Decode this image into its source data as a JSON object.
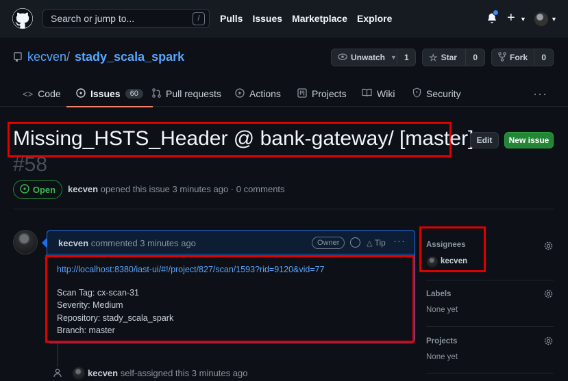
{
  "header": {
    "search_placeholder": "Search or jump to...",
    "search_shortcut": "/",
    "nav": [
      "Pulls",
      "Issues",
      "Marketplace",
      "Explore"
    ],
    "plus": "+"
  },
  "repo": {
    "owner": "kecven",
    "separator": "/",
    "name": "stady_scala_spark",
    "watch_label": "Unwatch",
    "watch_count": "1",
    "star_label": "Star",
    "star_count": "0",
    "fork_label": "Fork",
    "fork_count": "0"
  },
  "tabs": {
    "code": "Code",
    "issues": "Issues",
    "issues_count": "60",
    "pulls": "Pull requests",
    "actions": "Actions",
    "projects": "Projects",
    "wiki": "Wiki",
    "security": "Security",
    "more": "···"
  },
  "issue": {
    "title": "Missing_HSTS_Header @ bank-gateway/ [master]",
    "number": "#58",
    "state": "Open",
    "author": "kecven",
    "meta": "opened this issue 3 minutes ago · 0 comments",
    "edit_label": "Edit",
    "new_label": "New issue"
  },
  "comment": {
    "author": "kecven",
    "action": "commented 3 minutes ago",
    "owner_badge": "Owner",
    "tip": "Tip",
    "link": "http://localhost:8380/iast-ui/#!/project/827/scan/1593?rid=9120&vid=77",
    "lines": [
      "Scan Tag: cx-scan-31",
      "Severity: Medium",
      "Repository: stady_scala_spark",
      "Branch: master"
    ]
  },
  "event": {
    "actor": "kecven",
    "text": "self-assigned this 3 minutes ago"
  },
  "sidebar": {
    "assignees_heading": "Assignees",
    "assignee": "kecven",
    "labels_heading": "Labels",
    "labels_value": "None yet",
    "projects_heading": "Projects",
    "projects_value": "None yet"
  },
  "colors": {
    "accent": "#58a6ff",
    "open_green": "#3fb950",
    "new_issue_green": "#238636",
    "annotation_red": "#e00000",
    "tab_underline": "#f78166"
  }
}
